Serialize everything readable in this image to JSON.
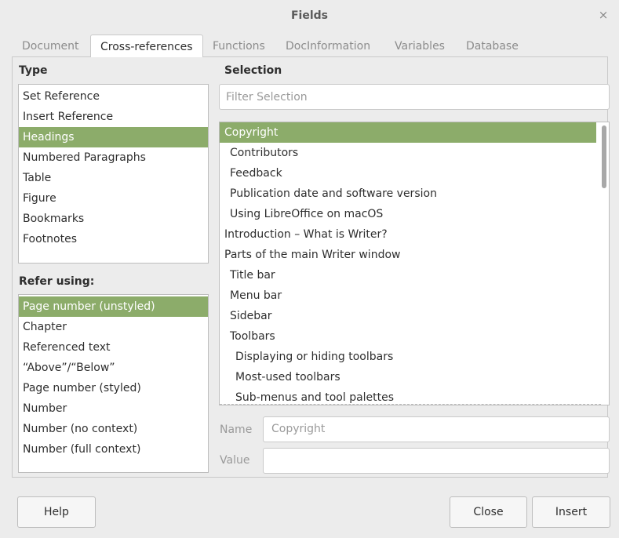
{
  "window": {
    "title": "Fields",
    "close_glyph": "×"
  },
  "tabs": [
    {
      "label": "Document",
      "active": false
    },
    {
      "label": "Cross-references",
      "active": true
    },
    {
      "label": "Functions",
      "active": false
    },
    {
      "label": "DocInformation",
      "active": false
    },
    {
      "label": "Variables",
      "active": false
    },
    {
      "label": "Database",
      "active": false
    }
  ],
  "type_section": {
    "label": "Type",
    "items": [
      "Set Reference",
      "Insert Reference",
      "Headings",
      "Numbered Paragraphs",
      "Table",
      "Figure",
      "Bookmarks",
      "Footnotes"
    ],
    "selected": "Headings"
  },
  "refer_section": {
    "label": "Refer using:",
    "items": [
      "Page number (unstyled)",
      "Chapter",
      "Referenced text",
      "“Above”/“Below”",
      "Page number (styled)",
      "Number",
      "Number (no context)",
      "Number (full context)"
    ],
    "selected": "Page number (unstyled)"
  },
  "selection_section": {
    "label": "Selection",
    "filter_placeholder": "Filter Selection",
    "items": [
      {
        "text": "Copyright",
        "level": 0,
        "selected": true
      },
      {
        "text": "Contributors",
        "level": 1
      },
      {
        "text": "Feedback",
        "level": 1
      },
      {
        "text": "Publication date and software version",
        "level": 1
      },
      {
        "text": "Using LibreOffice on macOS",
        "level": 1
      },
      {
        "text": "Introduction – What is Writer?",
        "level": 0
      },
      {
        "text": "Parts of the main Writer window",
        "level": 0
      },
      {
        "text": "Title bar",
        "level": 1
      },
      {
        "text": "Menu bar",
        "level": 1
      },
      {
        "text": "Sidebar",
        "level": 1
      },
      {
        "text": "Toolbars",
        "level": 1
      },
      {
        "text": "Displaying or hiding toolbars",
        "level": 2
      },
      {
        "text": "Most-used toolbars",
        "level": 2
      },
      {
        "text": "Sub-menus and tool palettes",
        "level": 2
      }
    ]
  },
  "name_field": {
    "label": "Name",
    "value": "Copyright"
  },
  "value_field": {
    "label": "Value",
    "value": ""
  },
  "buttons": {
    "help": "Help",
    "close": "Close",
    "insert": "Insert"
  },
  "colors": {
    "selection": "#8cac6a",
    "background": "#ececec"
  }
}
